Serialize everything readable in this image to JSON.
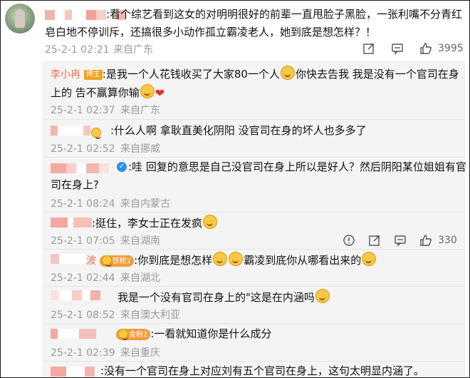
{
  "comment": {
    "text_line1": ":看个综艺看到这女的对明明很好的前辈一直甩脸子黑脸，一张利嘴不分青红",
    "text_line2": "皂白地不停训斥，还搞很多小动作孤立霸凌老人，她到底是想怎样？！",
    "time": "25-2-1 02:21",
    "location": "来自广东",
    "like_count": "3995"
  },
  "replies": [
    {
      "name": "李小冉",
      "badge": "博主",
      "text_line1": ":是我一个人花钱收买了大家80一个人",
      "text_line1b": "你快去告我 我是没有一个官司在身",
      "text_line2": "上的 告不赢算你输",
      "time": "25-2-1 02:37",
      "location": "来自广东"
    },
    {
      "text": ":什么人啊 拿耿直美化阴阳 没官司在身的坏人也多多了",
      "time": "25-2-1 02:52",
      "location": "来自挪威"
    },
    {
      "text_line1": ":哇 回复的意思是自己没官司在身上所以是好人？然后阴阳某位姐姐有官",
      "text_line2": "司在身上?",
      "time": "25-2-1 08:24",
      "location": "来自内蒙古"
    },
    {
      "text": ":挺住，李女士正在发疯",
      "time": "25-2-1 07:05",
      "location": "来自湖南",
      "like_count": "330"
    },
    {
      "name_tail": "波",
      "fan_badge": "铁粉2",
      "text_a": ":你到底是想怎样",
      "text_b": "霸凌到底你从哪看出来的",
      "time": "25-2-1 02:44",
      "location": "来自湖北"
    },
    {
      "text": "我是一个没有官司在身上的\"这是在内涵吗",
      "time": "25-2-1 08:52",
      "location": "来自澳大利亚"
    },
    {
      "fan_badge": "金粉2",
      "text": ":一看就知道你是什么成分",
      "time": "25-2-1 02:39",
      "location": "来自重庆"
    },
    {
      "text": ":没有一个官司在身上对应刘有五个官司在身上，这句太明显内涵了。"
    }
  ],
  "icons": {
    "share": "share-icon",
    "comment": "comment-icon",
    "like": "thumbs-up-icon",
    "info": "info-icon"
  },
  "colors": {
    "name_highlight": "#eb7350",
    "meta_gray": "#9a9a9a",
    "reply_bg": "#f4f4f4"
  }
}
